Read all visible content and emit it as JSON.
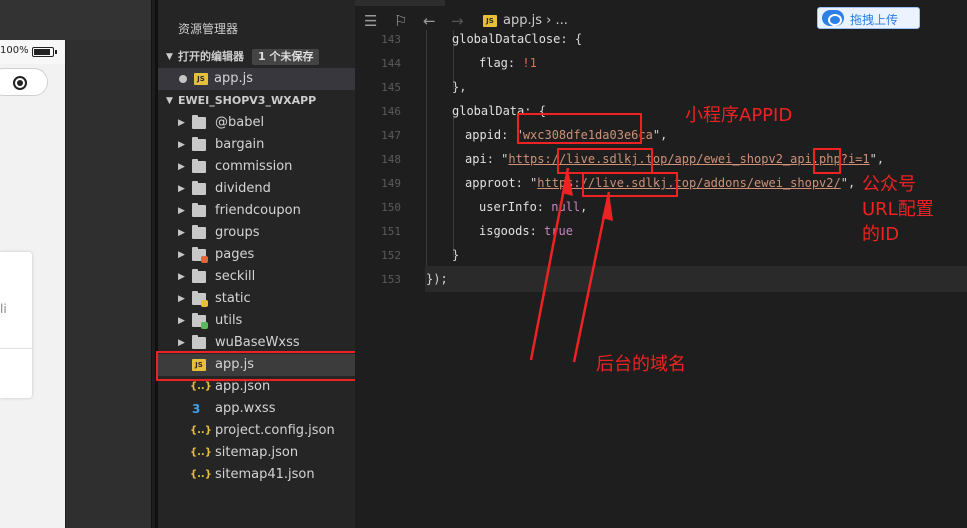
{
  "simulator": {
    "battery_percent": "100%"
  },
  "explorer": {
    "title": "资源管理器",
    "open_editors_label": "打开的编辑器",
    "unsaved_badge": "1 个未保存",
    "open_files": [
      {
        "name": "app.js",
        "modified": true
      }
    ],
    "project_label": "EWEI_SHOPV3_WXAPP",
    "items": [
      {
        "name": "@babel",
        "kind": "folder"
      },
      {
        "name": "bargain",
        "kind": "folder"
      },
      {
        "name": "commission",
        "kind": "folder"
      },
      {
        "name": "dividend",
        "kind": "folder"
      },
      {
        "name": "friendcoupon",
        "kind": "folder"
      },
      {
        "name": "groups",
        "kind": "folder"
      },
      {
        "name": "pages",
        "kind": "folder",
        "tag_color": "#e0653a"
      },
      {
        "name": "seckill",
        "kind": "folder"
      },
      {
        "name": "static",
        "kind": "folder",
        "tag_color": "#e6c03a"
      },
      {
        "name": "utils",
        "kind": "folder",
        "tag_color": "#5cb85c"
      },
      {
        "name": "wuBaseWxss",
        "kind": "folder"
      },
      {
        "name": "app.js",
        "kind": "js",
        "selected": true
      },
      {
        "name": "app.json",
        "kind": "json"
      },
      {
        "name": "app.wxss",
        "kind": "css"
      },
      {
        "name": "project.config.json",
        "kind": "json"
      },
      {
        "name": "sitemap.json",
        "kind": "json"
      },
      {
        "name": "sitemap41.json",
        "kind": "json"
      }
    ]
  },
  "editor": {
    "breadcrumb": "app.js › ...",
    "upload_button": "拖拽上传",
    "lines": {
      "l143": {
        "no": "143",
        "key": "globalDataClose",
        "tail": ": {"
      },
      "l144": {
        "no": "144",
        "key": "flag",
        "tail": ": ",
        "value": "!1"
      },
      "l145": {
        "no": "145",
        "text": "},"
      },
      "l146": {
        "no": "146",
        "key": "globalData",
        "tail": ": {"
      },
      "l147": {
        "no": "147",
        "key": "appid",
        "q1": ": \"",
        "value": "wxc308dfe1da03e6ca",
        "q2": "\","
      },
      "l148": {
        "no": "148",
        "key": "api",
        "q1": ": \"",
        "url_a": "https://",
        "url_b": "live.sdlkj.top",
        "url_c": "/app/ewei_shopv2_api.php?",
        "url_d": "i=1",
        "q2": "\","
      },
      "l149": {
        "no": "149",
        "key": "approot",
        "q1": ": \"",
        "url_a": "https://",
        "url_b": "live.sdlkj.top",
        "url_c": "/addons/ewei_shopv2/",
        "q2": "\","
      },
      "l150": {
        "no": "150",
        "key": "userInfo",
        "tail": ": ",
        "value": "null",
        "end": ","
      },
      "l151": {
        "no": "151",
        "key": "isgoods",
        "tail": ": ",
        "value": "true"
      },
      "l152": {
        "no": "152",
        "text": "}"
      },
      "l153": {
        "no": "153",
        "text": "});"
      }
    }
  },
  "annotations": {
    "appid_note": "小程序APPID",
    "uniacid_note": [
      "公众号",
      "URL配置",
      "的ID"
    ],
    "domain_note": "后台的域名"
  }
}
